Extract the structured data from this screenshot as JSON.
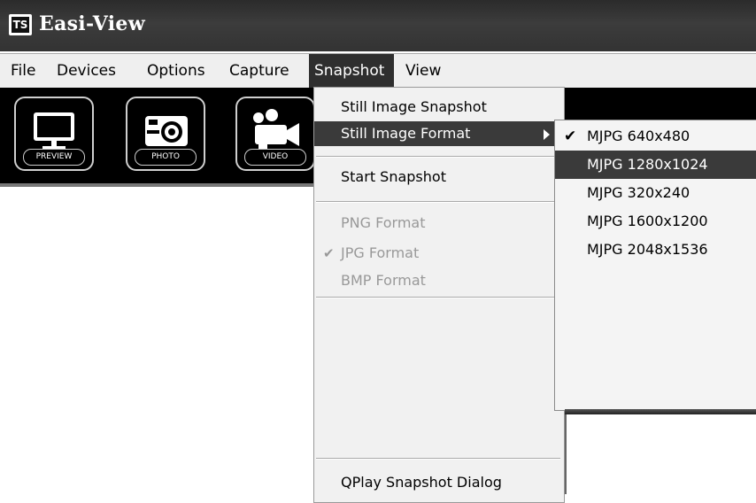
{
  "window": {
    "title": "Easi-View",
    "icon_text": "TS"
  },
  "menubar": {
    "items": [
      {
        "label": "File"
      },
      {
        "label": "Devices"
      },
      {
        "label": "Options"
      },
      {
        "label": "Capture"
      },
      {
        "label": "Snapshot",
        "active": true
      },
      {
        "label": "View"
      }
    ]
  },
  "toolbar": {
    "buttons": [
      {
        "label": "PREVIEW",
        "icon": "monitor-icon"
      },
      {
        "label": "PHOTO",
        "icon": "camera-icon"
      },
      {
        "label": "VIDEO",
        "icon": "video-camera-icon"
      }
    ]
  },
  "snapshot_menu": {
    "still_image_snapshot": "Still Image Snapshot",
    "still_image_format": "Still Image Format",
    "start_snapshot": "Start Snapshot",
    "png_format": "PNG Format",
    "jpg_format": "JPG Format",
    "jpg_checked": true,
    "bmp_format": "BMP Format",
    "qplay_dialog": "QPlay Snapshot Dialog"
  },
  "format_submenu": {
    "items": [
      {
        "label": "MJPG 640x480",
        "checked": true
      },
      {
        "label": "MJPG 1280x1024",
        "highlighted": true
      },
      {
        "label": "MJPG 320x240"
      },
      {
        "label": "MJPG 1600x1200"
      },
      {
        "label": "MJPG 2048x1536"
      }
    ]
  },
  "colors": {
    "titlebar": "#333333",
    "menu_highlight": "#3a3a3a",
    "toolbar_bg": "#000000"
  }
}
